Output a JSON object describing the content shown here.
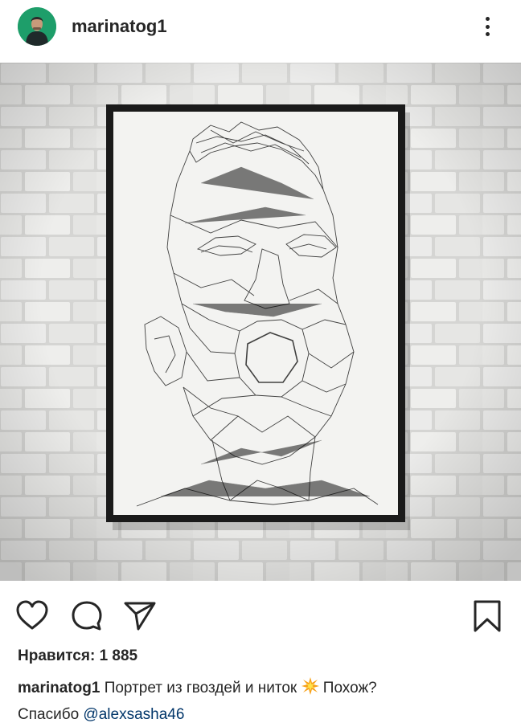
{
  "post": {
    "username": "marinatog1",
    "likes_text": "Нравится: 1 885",
    "caption_username": "marinatog1",
    "caption_text_1": " Портрет из гвоздей и ниток ",
    "caption_text_2": " Похож?",
    "caption_text_3": "Спасибо ",
    "caption_mention": "@alexsasha46"
  },
  "icons": {
    "avatar": "avatar",
    "more": "more-vertical-icon",
    "like": "heart-icon",
    "comment": "comment-icon",
    "share": "send-icon",
    "save": "bookmark-icon",
    "emoji": "collision-emoji-icon"
  },
  "colors": {
    "text": "#262626",
    "mention": "#003569",
    "avatar_bg": "#1e9e6a"
  }
}
